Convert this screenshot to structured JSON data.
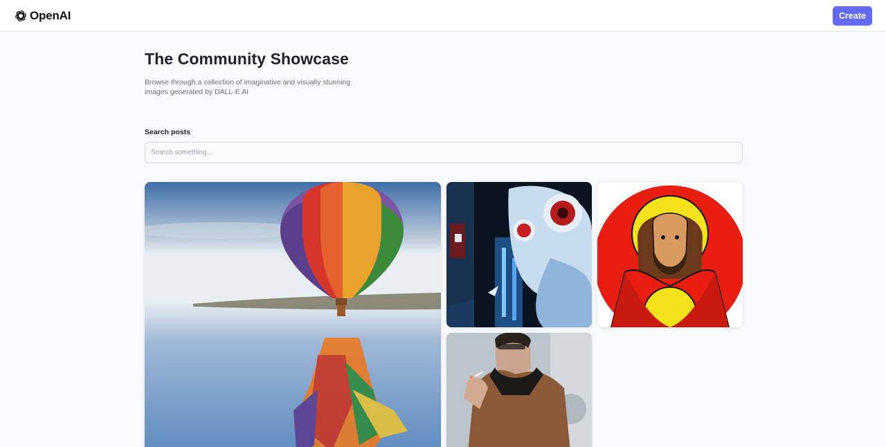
{
  "header": {
    "brand": "OpenAI",
    "logo_icon": "openai-logo-icon",
    "create_label": "Create"
  },
  "main": {
    "title": "The Community Showcase",
    "subtitle": "Browse through a collection of imaginative and visually stunning images generated by DALL-E AI",
    "search": {
      "label": "Search posts",
      "placeholder": "Search something...",
      "value": ""
    }
  },
  "gallery": {
    "posts": [
      {
        "subject": "hot-air-balloon-reflection"
      },
      {
        "subject": "robot-city-night"
      },
      {
        "subject": "haloed-figure-red-illustration"
      },
      {
        "subject": "man-coat-cigar"
      }
    ]
  },
  "colors": {
    "accent": "#6469ff",
    "page_background": "#f9fafe",
    "title_text": "#222328",
    "muted_text": "#666e75"
  }
}
